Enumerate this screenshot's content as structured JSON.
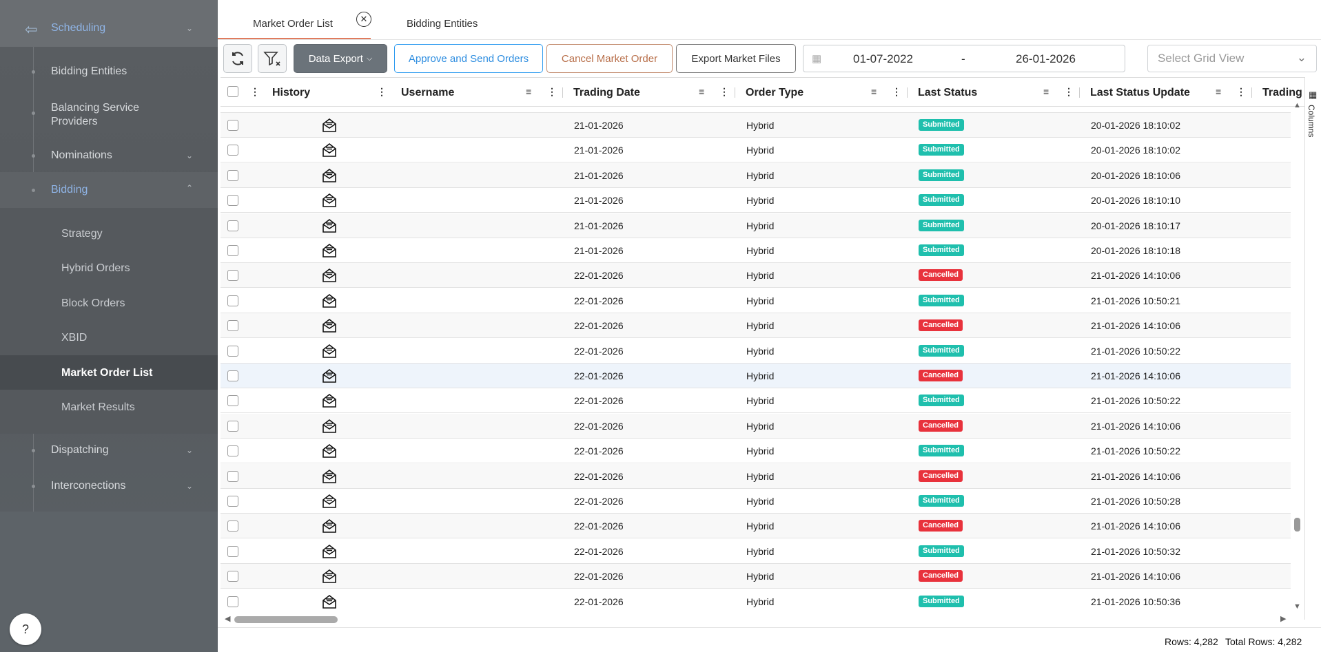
{
  "sidebar": {
    "header": "Scheduling",
    "items": [
      {
        "label": "Bidding Entities"
      },
      {
        "label": "Balancing Service Providers"
      },
      {
        "label": "Nominations"
      },
      {
        "label": "Bidding"
      },
      {
        "label": "Dispatching"
      },
      {
        "label": "Interconections"
      }
    ],
    "bidding_sub": [
      "Strategy",
      "Hybrid Orders",
      "Block Orders",
      "XBID",
      "Market Order List",
      "Market Results"
    ],
    "help": "?"
  },
  "tabs": [
    {
      "label": "Market Order List"
    },
    {
      "label": "Bidding Entities"
    }
  ],
  "toolbar": {
    "data_export": "Data Export",
    "approve": "Approve and Send Orders",
    "cancel": "Cancel Market Order",
    "export_files": "Export Market Files",
    "date_from": "01-07-2022",
    "date_sep": "-",
    "date_to": "26-01-2026",
    "grid_view_placeholder": "Select Grid View"
  },
  "columns": [
    "History",
    "Username",
    "Trading Date",
    "Order Type",
    "Last Status",
    "Last Status Update",
    "Trading"
  ],
  "side_panel_label": "Columns",
  "rows": [
    [
      "21-01-2026",
      "Hybrid",
      "Submitted",
      "20-01-2026 18:10:02"
    ],
    [
      "21-01-2026",
      "Hybrid",
      "Submitted",
      "20-01-2026 18:10:02"
    ],
    [
      "21-01-2026",
      "Hybrid",
      "Submitted",
      "20-01-2026 18:10:06"
    ],
    [
      "21-01-2026",
      "Hybrid",
      "Submitted",
      "20-01-2026 18:10:10"
    ],
    [
      "21-01-2026",
      "Hybrid",
      "Submitted",
      "20-01-2026 18:10:17"
    ],
    [
      "21-01-2026",
      "Hybrid",
      "Submitted",
      "20-01-2026 18:10:18"
    ],
    [
      "22-01-2026",
      "Hybrid",
      "Cancelled",
      "21-01-2026 14:10:06"
    ],
    [
      "22-01-2026",
      "Hybrid",
      "Submitted",
      "21-01-2026 10:50:21"
    ],
    [
      "22-01-2026",
      "Hybrid",
      "Cancelled",
      "21-01-2026 14:10:06"
    ],
    [
      "22-01-2026",
      "Hybrid",
      "Submitted",
      "21-01-2026 10:50:22"
    ],
    [
      "22-01-2026",
      "Hybrid",
      "Cancelled",
      "21-01-2026 14:10:06"
    ],
    [
      "22-01-2026",
      "Hybrid",
      "Submitted",
      "21-01-2026 10:50:22"
    ],
    [
      "22-01-2026",
      "Hybrid",
      "Cancelled",
      "21-01-2026 14:10:06"
    ],
    [
      "22-01-2026",
      "Hybrid",
      "Submitted",
      "21-01-2026 10:50:22"
    ],
    [
      "22-01-2026",
      "Hybrid",
      "Cancelled",
      "21-01-2026 14:10:06"
    ],
    [
      "22-01-2026",
      "Hybrid",
      "Submitted",
      "21-01-2026 10:50:28"
    ],
    [
      "22-01-2026",
      "Hybrid",
      "Cancelled",
      "21-01-2026 14:10:06"
    ],
    [
      "22-01-2026",
      "Hybrid",
      "Submitted",
      "21-01-2026 10:50:32"
    ],
    [
      "22-01-2026",
      "Hybrid",
      "Cancelled",
      "21-01-2026 14:10:06"
    ],
    [
      "22-01-2026",
      "Hybrid",
      "Submitted",
      "21-01-2026 10:50:36"
    ]
  ],
  "footer": {
    "rows": "Rows: 4,282",
    "total_rows": "Total Rows: 4,282"
  },
  "colors": {
    "submitted": "#1fbfad",
    "cancelled": "#e8323c",
    "accent": "#e07b5d"
  }
}
